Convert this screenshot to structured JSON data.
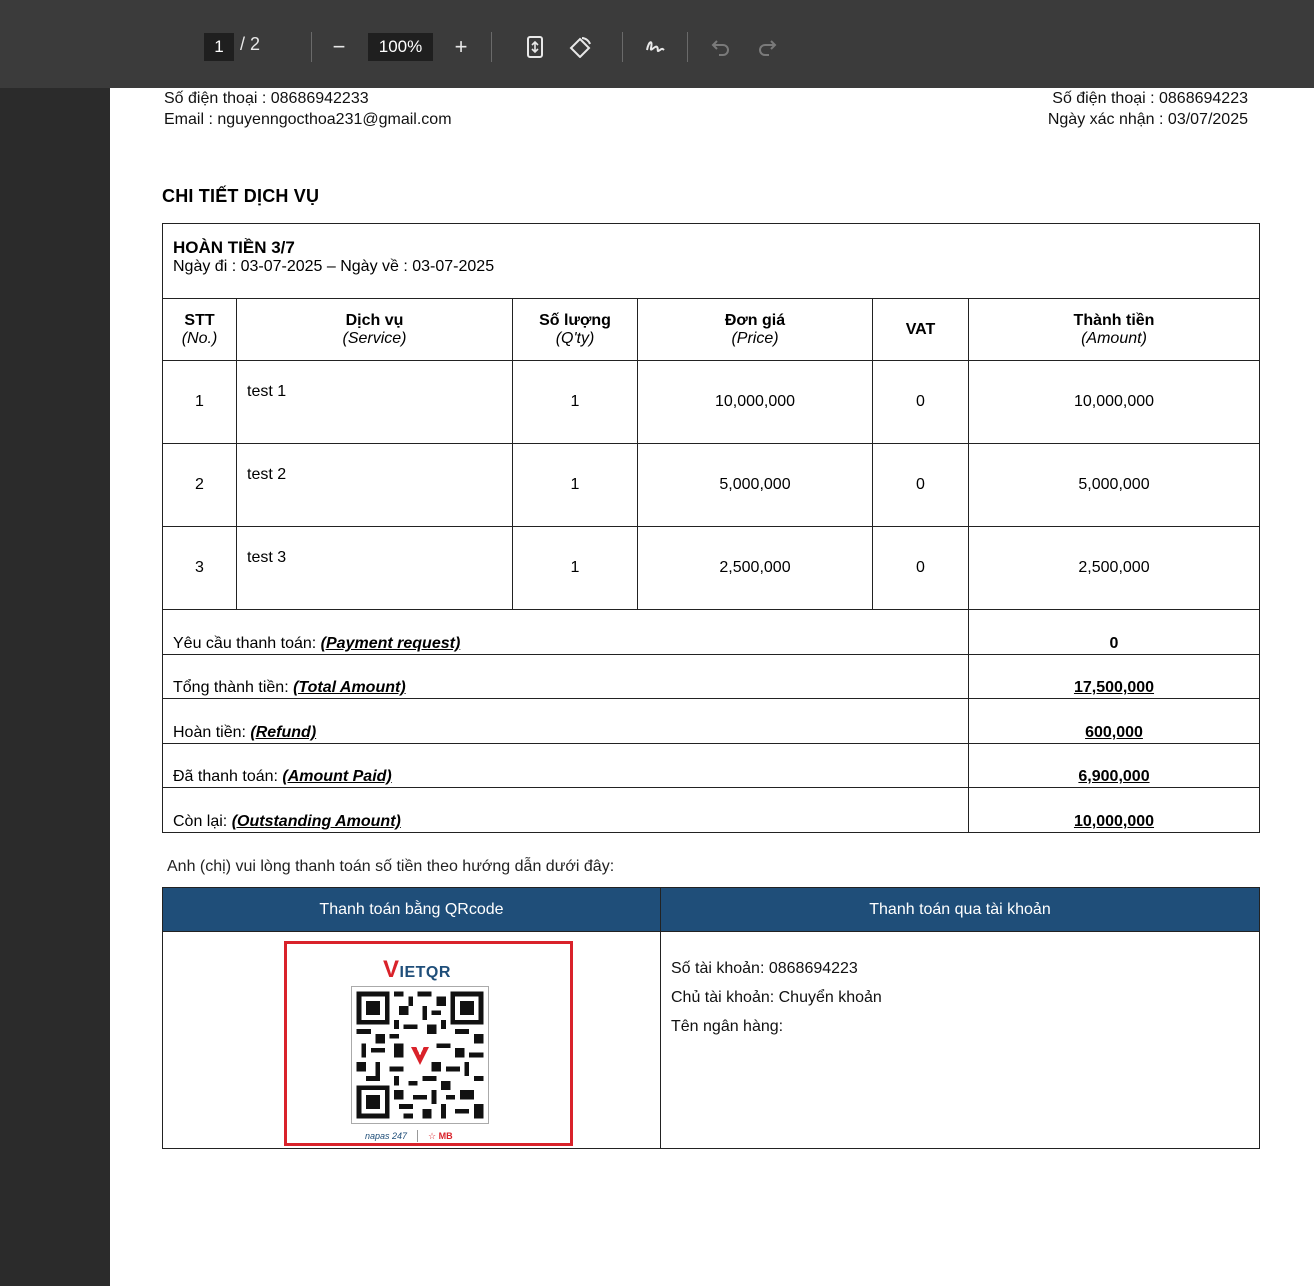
{
  "toolbar": {
    "current_page": "1",
    "total_pages": "/ 2",
    "zoom_out": "−",
    "zoom": "100%",
    "zoom_in": "+"
  },
  "header": {
    "left_phone": "Số điện thoại : 08686942233",
    "left_email": "Email : nguyenngocthoa231@gmail.com",
    "right_phone": "Số điện thoại : 0868694223",
    "right_date": "Ngày xác nhận : 03/07/2025"
  },
  "section_title": "CHI TIẾT DỊCH VỤ",
  "service": {
    "title": "HOÀN TIỀN 3/7",
    "dates": "Ngày đi : 03-07-2025 – Ngày về : 03-07-2025",
    "columns": [
      {
        "main": "STT",
        "sub": "(No.)"
      },
      {
        "main": "Dịch vụ",
        "sub": "(Service)"
      },
      {
        "main": "Số lượng",
        "sub": "(Q'ty)"
      },
      {
        "main": "Đơn giá",
        "sub": "(Price)"
      },
      {
        "main": "VAT",
        "sub": ""
      },
      {
        "main": "Thành tiền",
        "sub": "(Amount)"
      }
    ],
    "rows": [
      {
        "no": "1",
        "service": "test 1",
        "qty": "1",
        "price": "10,000,000",
        "vat": "0",
        "amount": "10,000,000"
      },
      {
        "no": "2",
        "service": "test 2",
        "qty": "1",
        "price": "5,000,000",
        "vat": "0",
        "amount": "5,000,000"
      },
      {
        "no": "3",
        "service": "test 3",
        "qty": "1",
        "price": "2,500,000",
        "vat": "0",
        "amount": "2,500,000"
      }
    ],
    "summary": [
      {
        "label": "Yêu cầu thanh toán: ",
        "label_en": "(Payment request)",
        "value": "0"
      },
      {
        "label": "Tổng thành tiền: ",
        "label_en": "(Total Amount)",
        "value": "17,500,000"
      },
      {
        "label": "Hoàn tiền: ",
        "label_en": "(Refund)",
        "value": "600,000"
      },
      {
        "label": "Đã thanh toán: ",
        "label_en": "(Amount Paid)",
        "value": "6,900,000"
      },
      {
        "label": "Còn lại: ",
        "label_en": "(Outstanding Amount)",
        "value": "10,000,000"
      }
    ]
  },
  "payment": {
    "intro": "Anh (chị) vui lòng thanh toán số tiền theo hướng dẫn dưới đây:",
    "qr_header": "Thanh toán bằng QRcode",
    "account_header": "Thanh toán qua tài khoản",
    "qr_logo_v": "V",
    "qr_logo_rest": "IETQR",
    "qr_footer_left": "napas 247",
    "qr_footer_right": "MB",
    "account_number": "Số tài khoản: 0868694223",
    "account_holder": "Chủ tài khoản: Chuyển khoản",
    "bank_name": "Tên ngân hàng:"
  },
  "colors": {
    "header_blue": "#1f4e79",
    "qr_red": "#d9222a",
    "toolbar_bg": "#3b3b3b"
  }
}
